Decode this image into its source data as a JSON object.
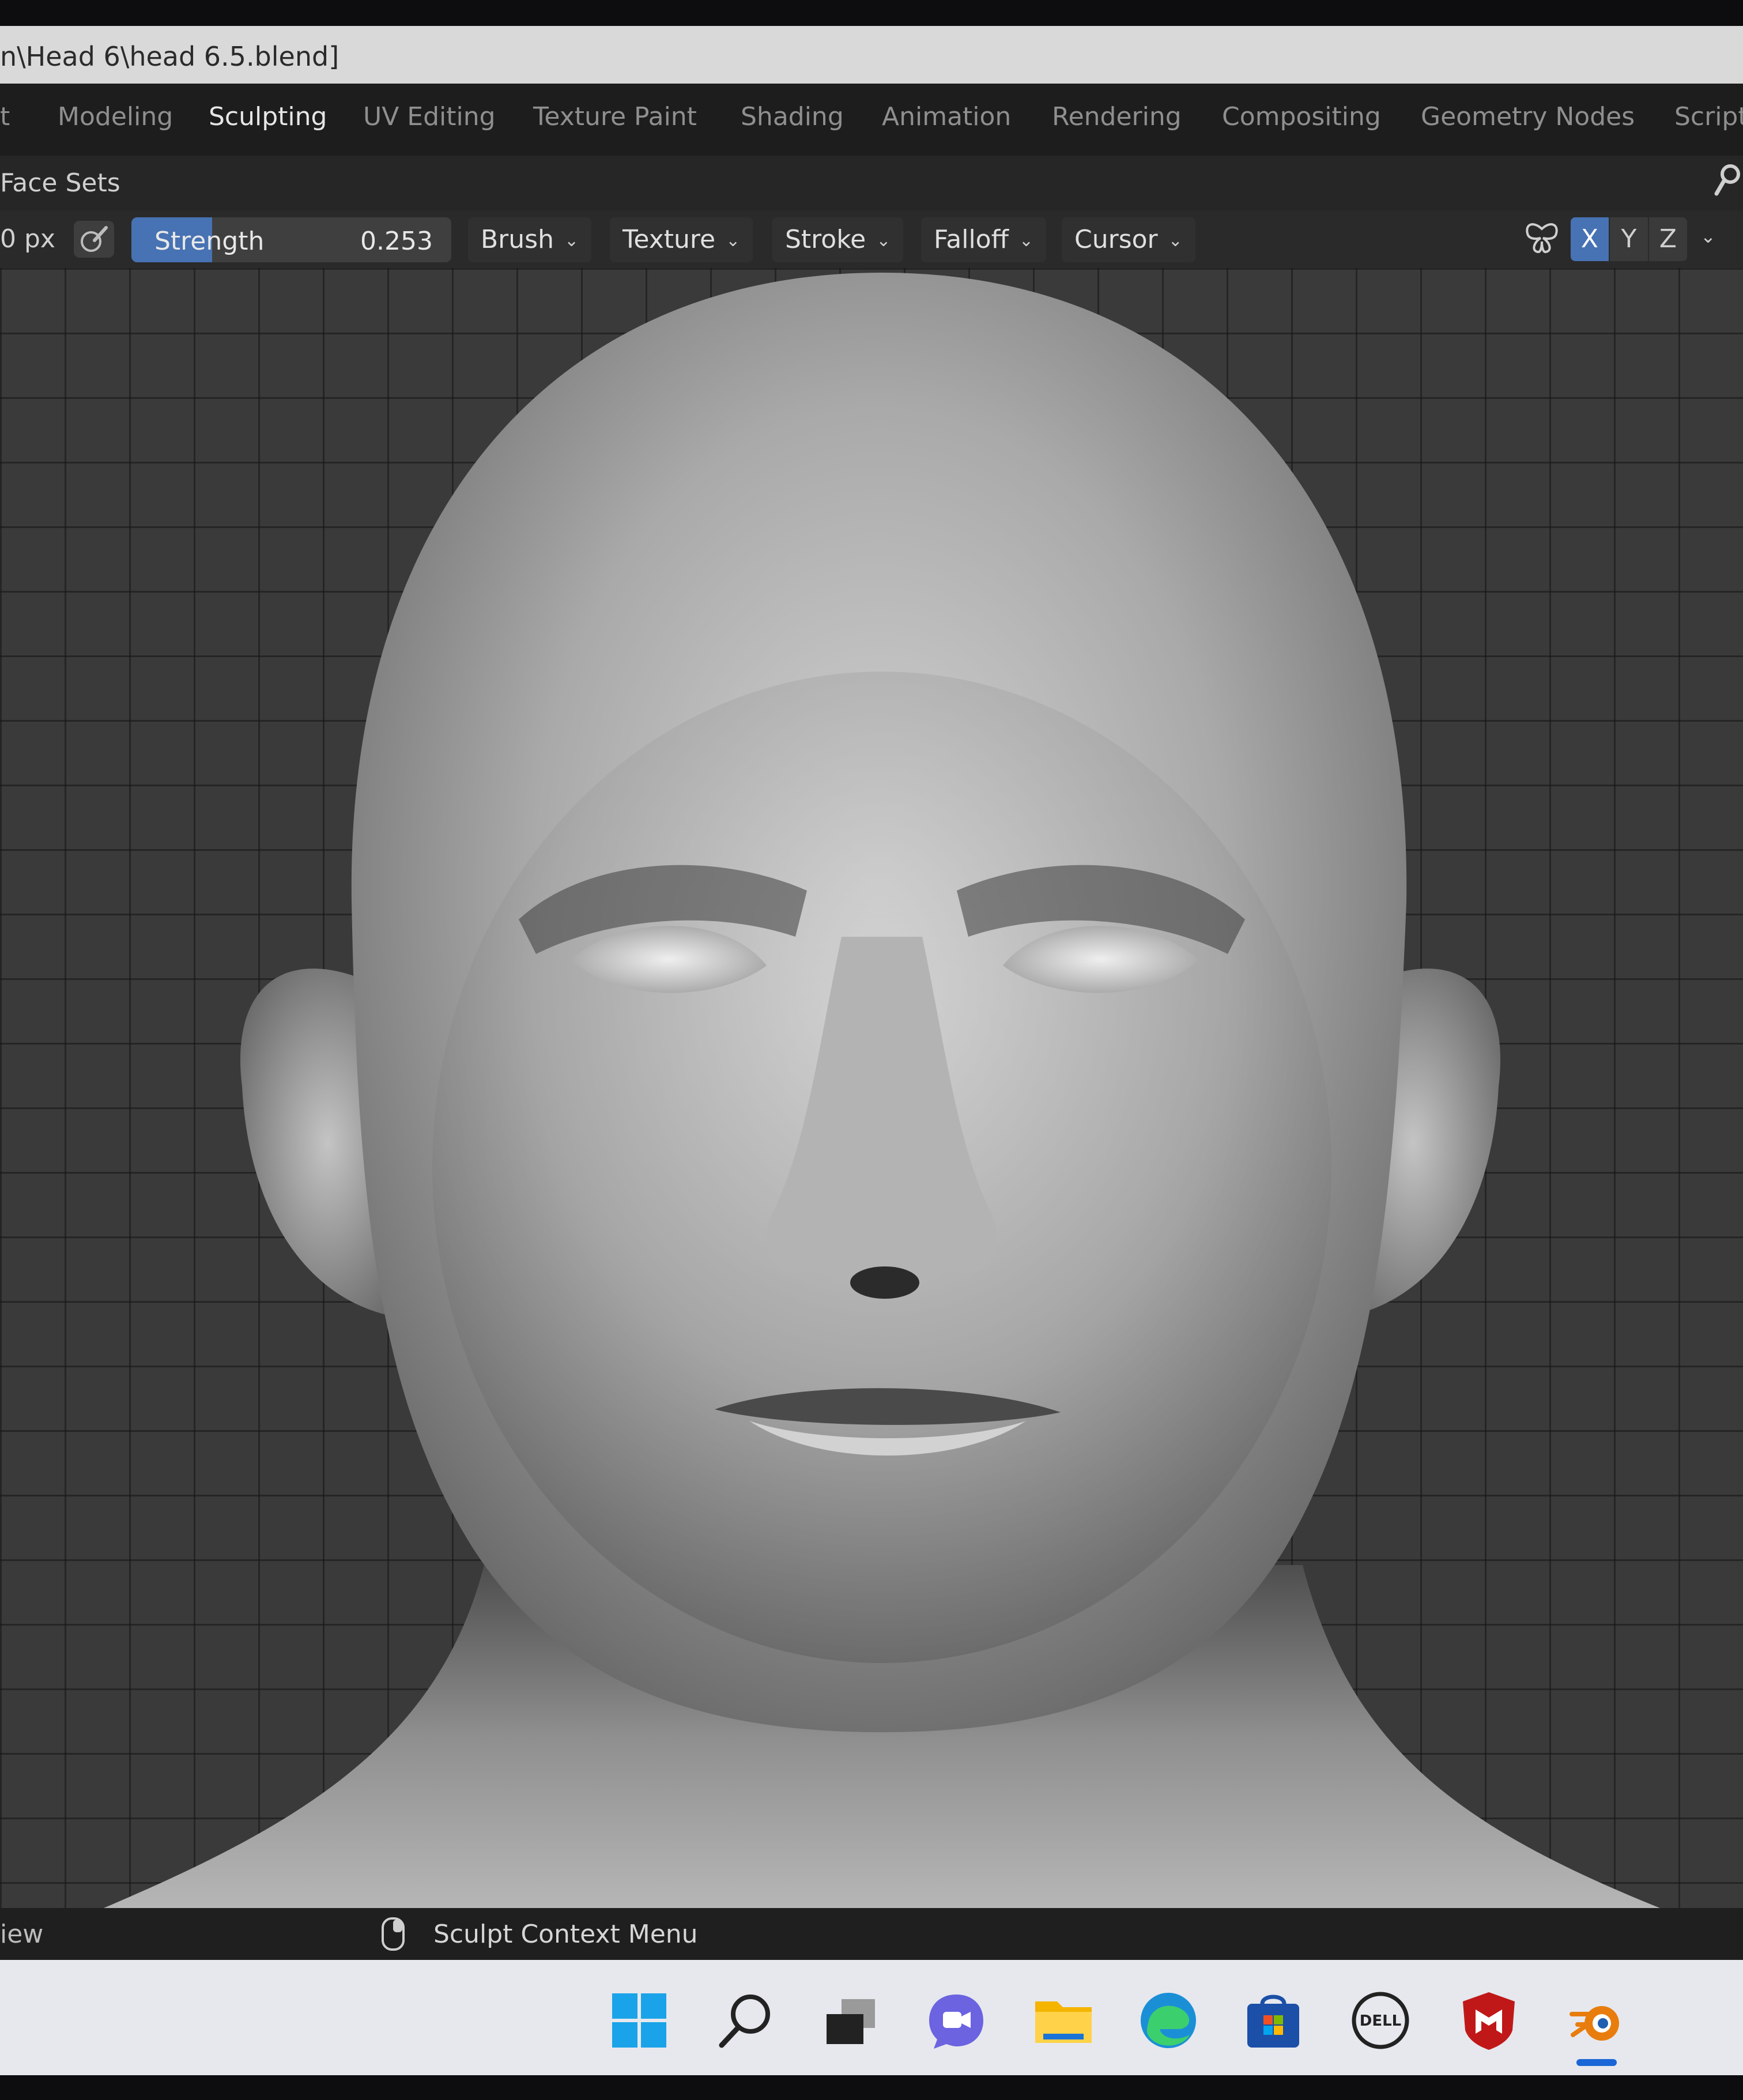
{
  "window": {
    "title": "n\\Head 6\\head 6.5.blend]"
  },
  "workspace_tabs": [
    {
      "label": "t"
    },
    {
      "label": "Modeling"
    },
    {
      "label": "Sculpting",
      "active": true
    },
    {
      "label": "UV Editing"
    },
    {
      "label": "Texture Paint"
    },
    {
      "label": "Shading"
    },
    {
      "label": "Animation"
    },
    {
      "label": "Rendering"
    },
    {
      "label": "Compositing"
    },
    {
      "label": "Geometry Nodes"
    },
    {
      "label": "Script"
    }
  ],
  "header": {
    "face_sets_label": "Face Sets",
    "pin_icon": "pin-icon"
  },
  "toolbar": {
    "radius_value": "0 px",
    "strength": {
      "label": "Strength",
      "value": "0.253",
      "fraction": 0.253
    },
    "menus": [
      "Brush",
      "Texture",
      "Stroke",
      "Falloff",
      "Cursor"
    ],
    "symmetry_icon": "butterfly-symmetry-icon",
    "axes": [
      {
        "label": "X",
        "active": true
      },
      {
        "label": "Y",
        "active": false
      },
      {
        "label": "Z",
        "active": false
      }
    ],
    "colors": {
      "accent": "#4772b3"
    }
  },
  "viewport": {
    "object": "sculpted-head",
    "background": "#3a3a3a"
  },
  "statusbar": {
    "left_text": "iew",
    "context_menu_label": "Sculpt Context Menu"
  },
  "taskbar": {
    "icons": [
      "windows-start-icon",
      "search-icon",
      "task-view-icon",
      "chat-icon",
      "file-explorer-icon",
      "edge-icon",
      "store-icon",
      "dell-icon",
      "mcafee-icon",
      "blender-icon"
    ],
    "active": "blender-icon",
    "colors": {
      "blender": "#e87d0d",
      "windows": "#1aa3e8"
    }
  }
}
